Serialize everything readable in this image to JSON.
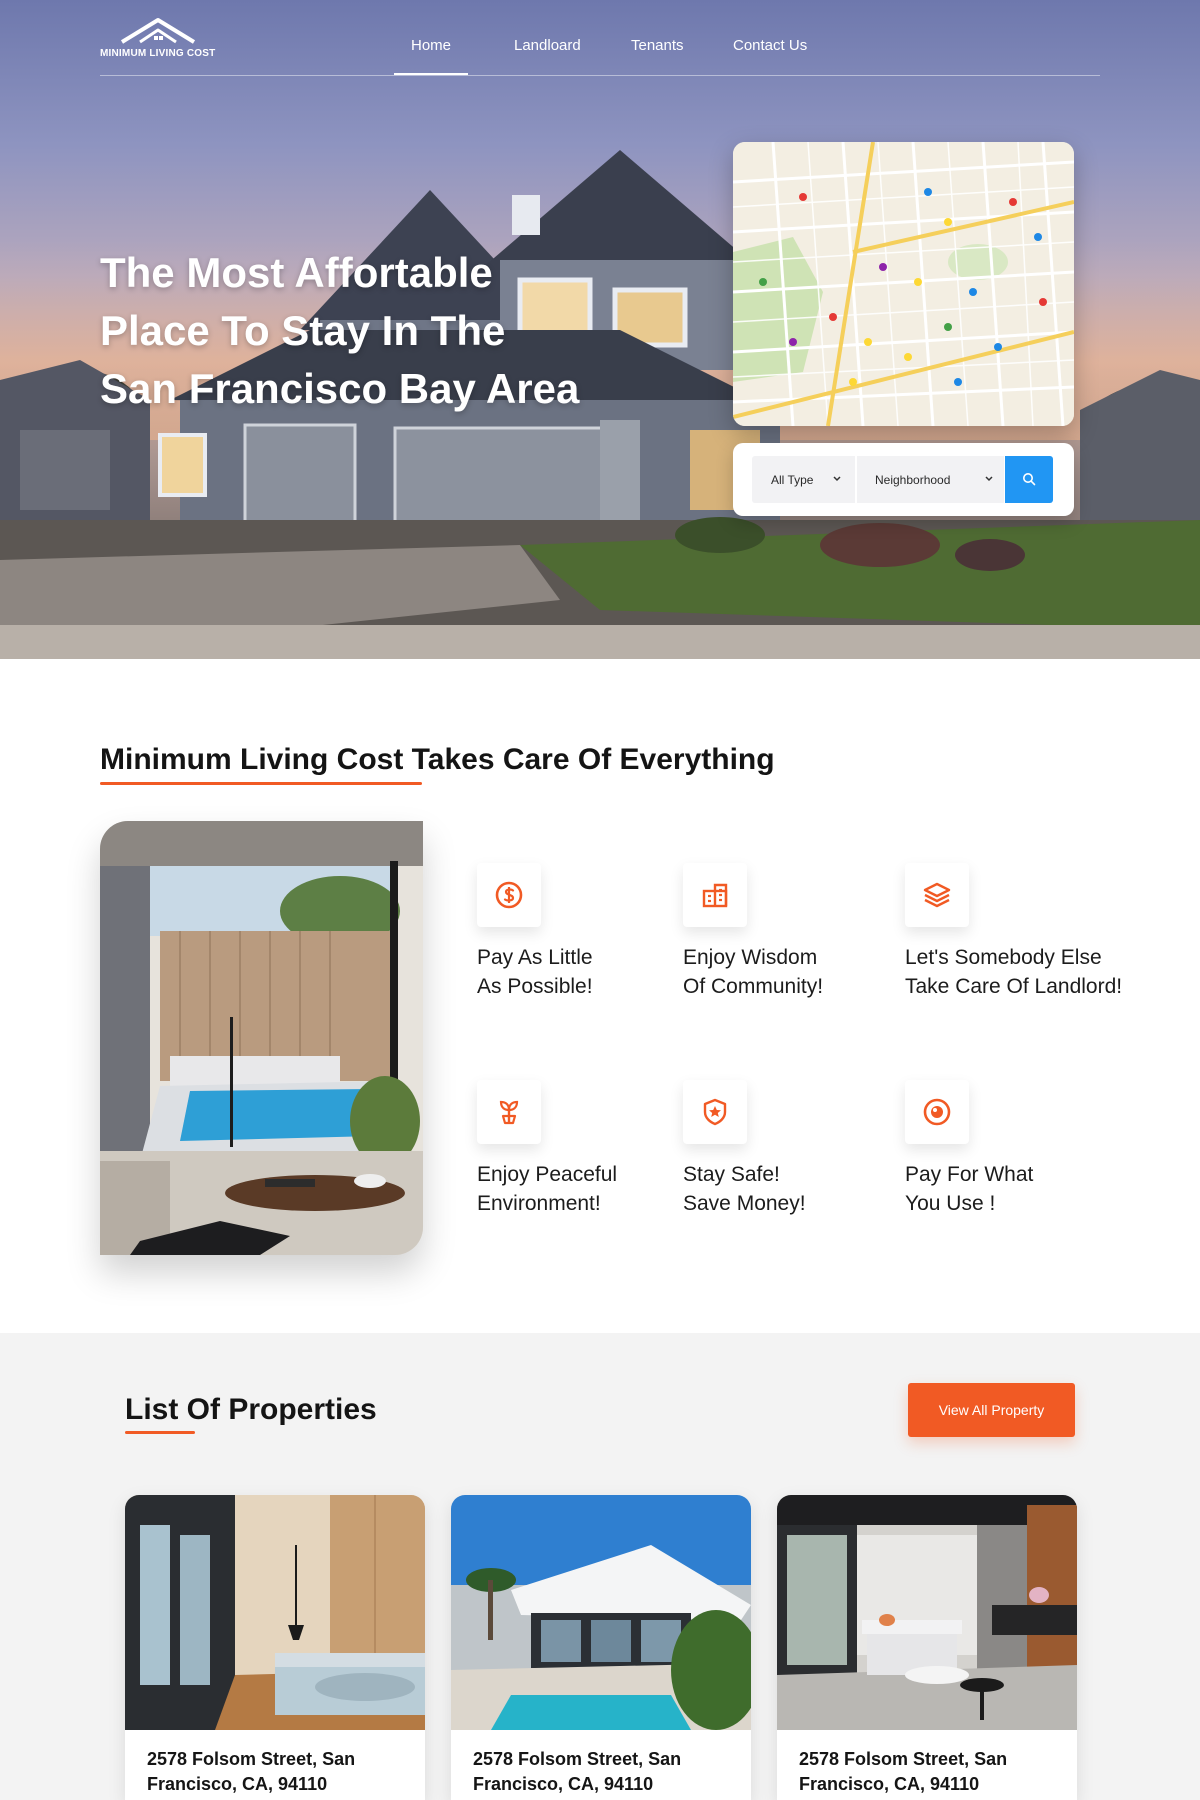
{
  "brand": {
    "logo_text": "MINIMUM LIVING COST"
  },
  "nav": {
    "items": [
      {
        "label": "Home",
        "active": true
      },
      {
        "label": "Landloard",
        "active": false
      },
      {
        "label": "Tenants",
        "active": false
      },
      {
        "label": "Contact Us",
        "active": false
      }
    ]
  },
  "hero": {
    "title_lines": [
      "The Most Affortable",
      "Place To Stay In The",
      "San Francisco Bay Area"
    ],
    "search": {
      "type_value": "All Type",
      "neighborhood_value": "Neighborhood"
    }
  },
  "features": {
    "title": "Minimum Living Cost Takes Care Of Everything",
    "items": [
      {
        "line1": "Pay As Little",
        "line2": "As Possible!",
        "icon": "dollar-icon"
      },
      {
        "line1": "Enjoy Wisdom",
        "line2": "Of Community!",
        "icon": "building-icon"
      },
      {
        "line1": "Let's Somebody Else",
        "line2": "Take Care Of Landlord!",
        "icon": "layers-icon"
      },
      {
        "line1": "Enjoy Peaceful",
        "line2": "Environment!",
        "icon": "plant-icon"
      },
      {
        "line1": "Stay Safe!",
        "line2": "Save Money!",
        "icon": "shield-star-icon"
      },
      {
        "line1": "Pay For What",
        "line2": "You Use !",
        "icon": "meter-icon"
      }
    ]
  },
  "properties": {
    "title": "List Of Properties",
    "view_all_label": "View All Property",
    "items": [
      {
        "address_line1": "2578 Folsom Street, San",
        "address_line2": "Francisco, CA, 94110"
      },
      {
        "address_line1": "2578 Folsom Street, San",
        "address_line2": "Francisco, CA, 94110"
      },
      {
        "address_line1": "2578 Folsom Street, San",
        "address_line2": "Francisco, CA, 94110"
      }
    ]
  },
  "colors": {
    "accent": "#f15a24",
    "search_button": "#2196f3",
    "text_dark": "#141414",
    "section_bg": "#f3f3f3"
  }
}
